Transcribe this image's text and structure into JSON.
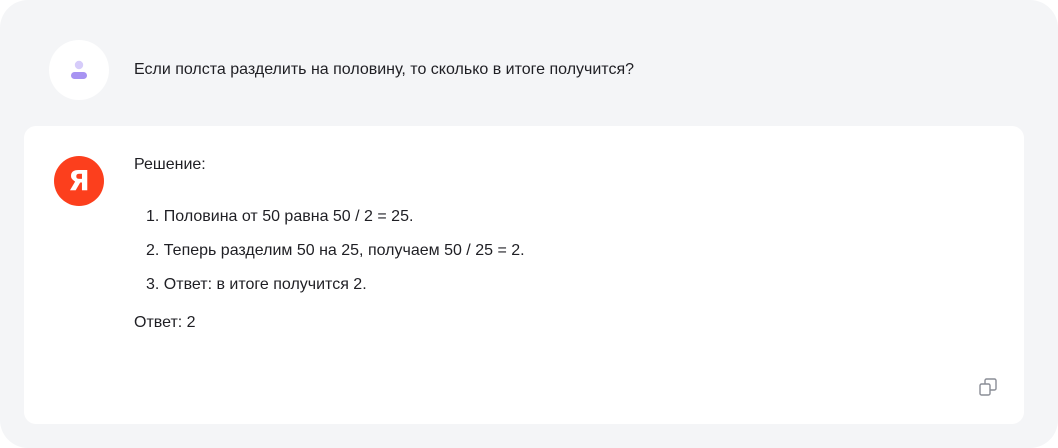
{
  "user_message": {
    "avatar_icon": "user-avatar-icon",
    "text": "Если полста разделить на половину, то сколько в итоге получится?"
  },
  "assistant_message": {
    "logo_letter": "Я",
    "logo_color": "#fc3f1d",
    "heading": "Решение:",
    "steps": [
      "1. Половина от 50 равна 50 / 2 = 25.",
      "2. Теперь разделим 50 на 25, получаем 50 / 25 = 2.",
      "3. Ответ: в итоге получится 2."
    ],
    "final_answer": "Ответ: 2",
    "copy_icon": "copy-icon"
  },
  "colors": {
    "background": "#f4f5f7",
    "card": "#ffffff",
    "accent_avatar": "#b9a7f4",
    "text": "#1f1f24",
    "icon": "#8a8d96"
  }
}
